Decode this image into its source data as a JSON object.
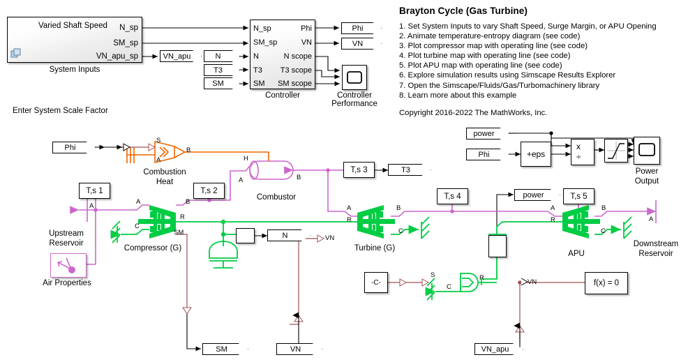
{
  "info": {
    "title": "Brayton Cycle (Gas Turbine)",
    "steps": [
      "1. Set System Inputs to vary Shaft Speed, Surge Margin, or APU Opening",
      "2. Animate temperature-entropy diagram (see code)",
      "3. Plot compressor map with operating line (see code)",
      "4. Plot turbine map with operating line (see code)",
      "5. Plot APU map with operating line (see code)",
      "6. Explore simulation results using Simscape Results Explorer",
      "7. Open the Simscape/Fluids/Gas/Turbomachinery library",
      "8. Learn more about this example"
    ],
    "copyright": "Copyright 2016-2022 The MathWorks, Inc."
  },
  "colors": {
    "physical_gas": "#cc66cc",
    "mechanical": "#00cc44",
    "thermal": "#ee6600",
    "physical_signal": "#a05050",
    "signal": "#000000"
  },
  "system_inputs": {
    "title": "Varied Shaft Speed",
    "caption": "System Inputs",
    "outputs": [
      "N_sp",
      "SM_sp",
      "VN_apu_sp"
    ],
    "note": "Enter System Scale Factor"
  },
  "controller": {
    "caption": "Controller",
    "inputs": [
      "N_sp",
      "SM_sp",
      "N",
      "T3",
      "SM"
    ],
    "outputs": [
      "Phi",
      "VN",
      "N scope",
      "T3 scope",
      "SM scope"
    ]
  },
  "scope": {
    "caption": "Controller\nPerformance"
  },
  "tags": {
    "vn_apu_top": "VN_apu",
    "phi_out": "Phi",
    "vn_out": "VN",
    "n_in": "N",
    "t3_in": "T3",
    "sm_in": "SM",
    "phi_in": "Phi",
    "t3_from_sensor": "T3",
    "n_from_sensor": "N",
    "sm_bottom": "SM",
    "vn_bottom": "VN",
    "vn_apu_bottom": "VN_apu",
    "power_in": "power",
    "phi_power_in": "Phi",
    "power_out": "power"
  },
  "power_section": {
    "eps_block": "+eps",
    "product_mul": "x",
    "product_div": "÷",
    "scope_caption": "Power\nOutput"
  },
  "plant": {
    "combustion_heat": "Combustion\nHeat",
    "combustor": "Combustor",
    "compressor": "Compressor (G)",
    "turbine": "Turbine (G)",
    "apu": "APU",
    "upstream_reservoir": "Upstream\nReservoir",
    "downstream_reservoir": "Downstream\nReservoir",
    "air_properties": "Air Properties",
    "constant": "-C-",
    "solver": "f(x) = 0"
  },
  "sensors": {
    "ts1": "T,s 1",
    "ts2": "T,s 2",
    "ts3": "T,s 3",
    "ts4": "T,s 4",
    "ts5": "T,s 5"
  },
  "port_labels": {
    "A": "A",
    "B": "B",
    "C": "C",
    "R": "R",
    "S": "S",
    "H": "H",
    "SM": "SM",
    "VN": "VN"
  }
}
